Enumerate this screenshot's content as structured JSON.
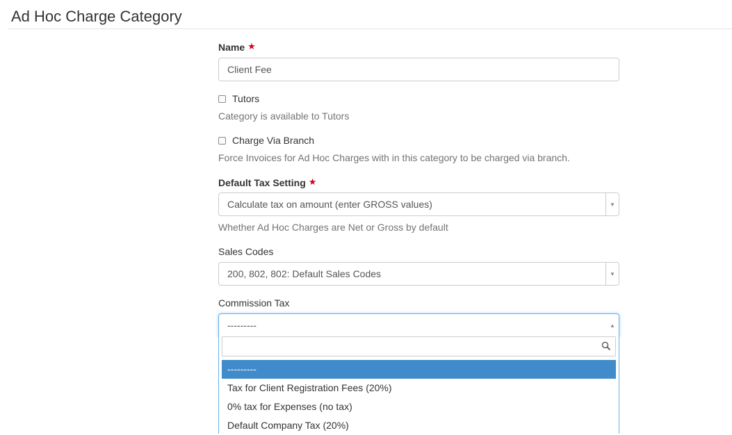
{
  "page": {
    "title": "Ad Hoc Charge Category"
  },
  "form": {
    "name": {
      "label": "Name",
      "required_marker": "★",
      "value": "Client Fee"
    },
    "tutors": {
      "label": "Tutors",
      "checked": false,
      "help": "Category is available to Tutors"
    },
    "charge_via_branch": {
      "label": "Charge Via Branch",
      "checked": false,
      "help": "Force Invoices for Ad Hoc Charges with in this category to be charged via branch."
    },
    "default_tax_setting": {
      "label": "Default Tax Setting",
      "required_marker": "★",
      "value": "Calculate tax on amount (enter GROSS values)",
      "help": "Whether Ad Hoc Charges are Net or Gross by default"
    },
    "sales_codes": {
      "label": "Sales Codes",
      "value": "200, 802, 802: Default Sales Codes"
    },
    "commission_tax": {
      "label": "Commission Tax",
      "value": "---------",
      "dropdown_open": true,
      "search_value": "",
      "options": [
        {
          "label": "---------",
          "highlighted": true
        },
        {
          "label": "Tax for Client Registration Fees (20%)",
          "highlighted": false
        },
        {
          "label": "0% tax for Expenses (no tax)",
          "highlighted": false
        },
        {
          "label": "Default Company Tax (20%)",
          "highlighted": false
        }
      ]
    }
  },
  "icons": {
    "select_arrow_down": "▼",
    "select_arrow_up": "▲",
    "search": "search-icon"
  },
  "colors": {
    "required": "#d0021b",
    "focus_border": "#66afe9",
    "highlight": "#428bca"
  }
}
